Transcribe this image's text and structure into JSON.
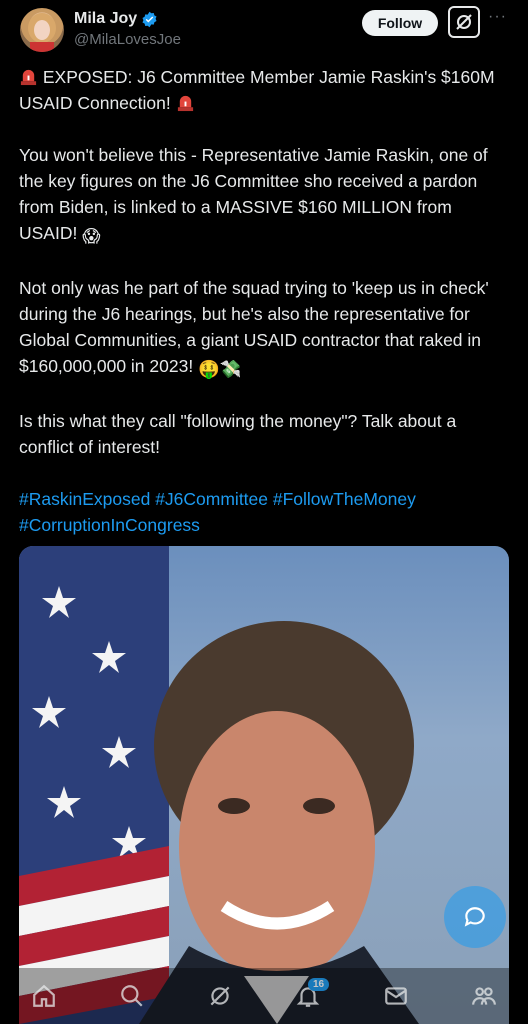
{
  "author": {
    "display_name": "Mila Joy",
    "handle": "@MilaLovesJoe",
    "verified_icon": "verified-badge-icon"
  },
  "actions": {
    "follow_label": "Follow",
    "grok_icon": "grok-icon",
    "more_icon": "more-icon"
  },
  "tweet": {
    "headline": "EXPOSED: J6 Committee Member Jamie Raskin's $160M USAID Connection!",
    "para1": "You won't believe this - Representative Jamie Raskin, one of the key figures on the J6 Committee sho received a pardon from Biden, is linked to a MASSIVE $160 MILLION from USAID!",
    "para2": "Not only was he part of the squad trying to 'keep us in check' during the J6 hearings, but he's also the representative for Global Communities, a giant USAID contractor that raked in $160,000,000 in 2023!",
    "para3": "Is this what they call \"following the money\"? Talk about a conflict of interest!",
    "hashtags": "#RaskinExposed #J6Committee #FollowTheMoney #CorruptionInCongress",
    "emoji_shocked": "😱",
    "emoji_money": "🤑💸"
  },
  "nav": {
    "notifications_badge": "16",
    "items": [
      "home-icon",
      "search-icon",
      "grok-icon",
      "notifications-icon",
      "messages-icon",
      "communities-icon"
    ]
  },
  "colors": {
    "accent": "#1d9bf0",
    "background": "#000000",
    "text": "#e7e9ea",
    "muted": "#71767b"
  }
}
